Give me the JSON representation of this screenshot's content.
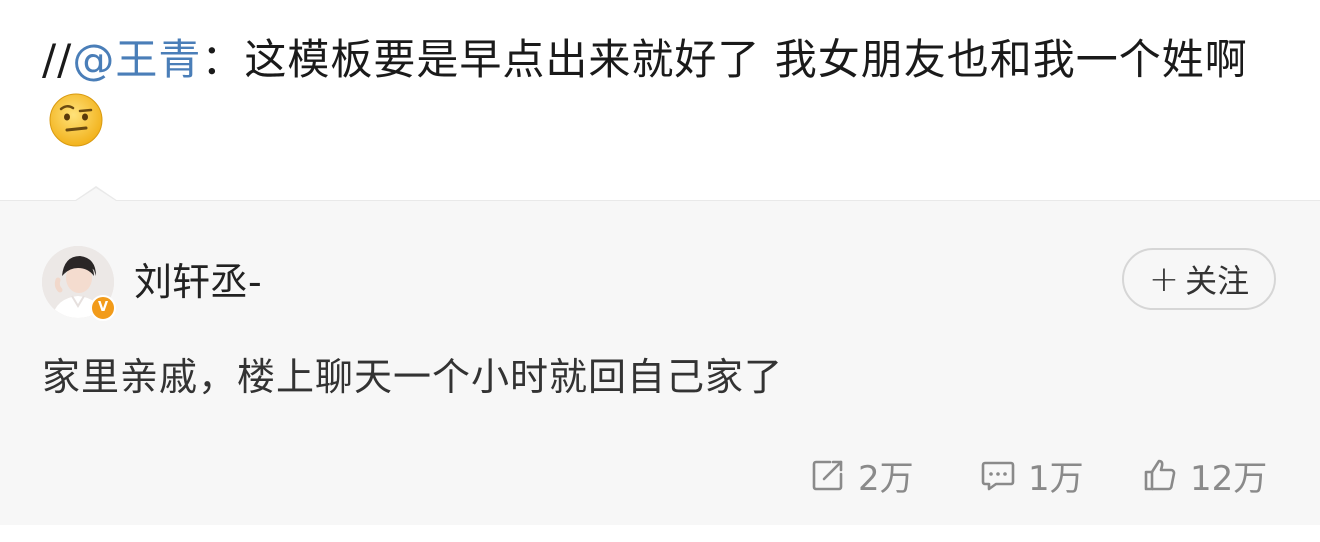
{
  "repost": {
    "prefix": "//",
    "mention": "@王青",
    "colon": "：",
    "text": "这模板要是早点出来就好了 我女朋友也和我一个姓啊"
  },
  "emoji": {
    "name": "raised-eyebrow-face-icon"
  },
  "original_post": {
    "author": {
      "name": "刘轩丞-",
      "verified_badge": "V",
      "verified_color": "#f29b1a"
    },
    "follow_button": {
      "plus": "+",
      "label": "关注"
    },
    "text": "家里亲戚，楼上聊天一个小时就回自己家了",
    "actions": {
      "repost": {
        "icon": "repost-icon",
        "count": "2万"
      },
      "comment": {
        "icon": "comment-icon",
        "count": "1万"
      },
      "like": {
        "icon": "thumbs-up-icon",
        "count": "12万"
      }
    }
  },
  "colors": {
    "mention": "#4a7eb8",
    "card_background": "#f7f7f7",
    "muted": "#8a8a8a"
  }
}
